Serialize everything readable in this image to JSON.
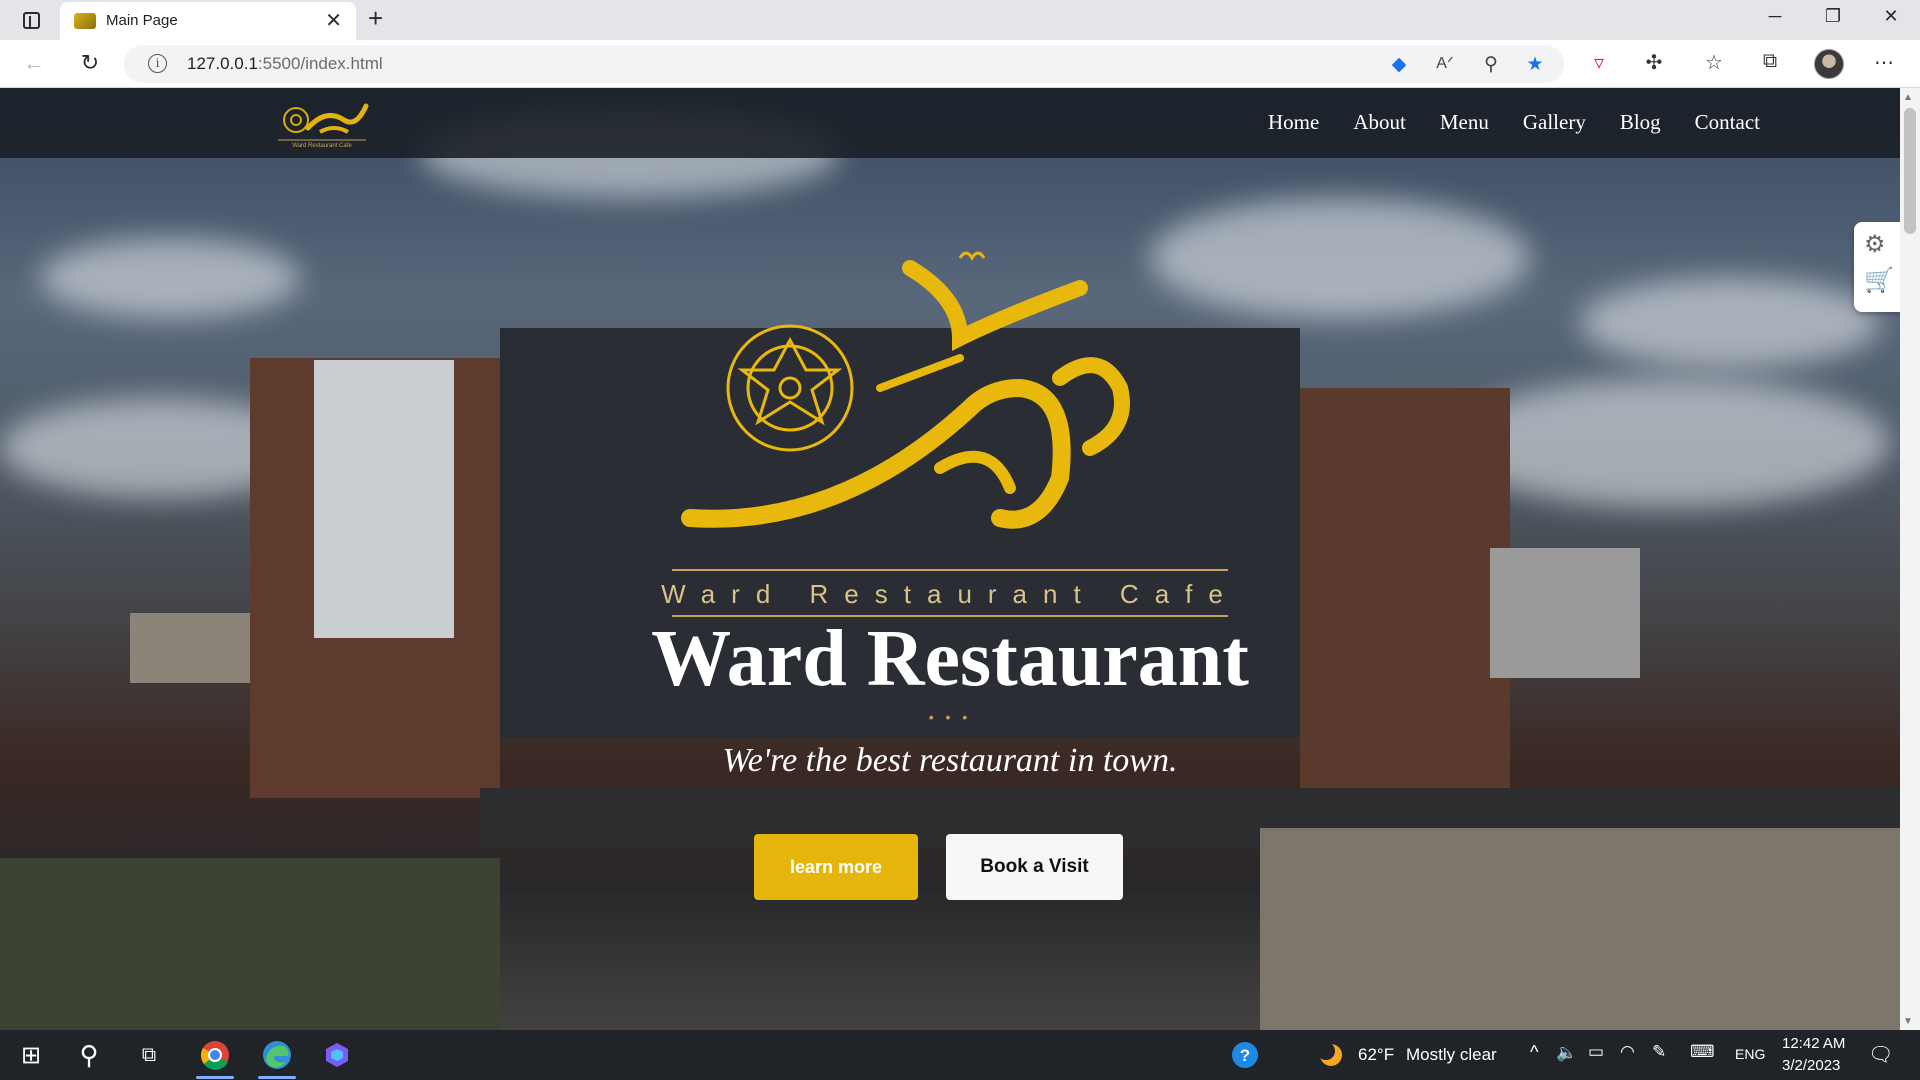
{
  "browser": {
    "tab_title": "Main Page",
    "url_host": "127.0.0.1",
    "url_path": ":5500/index.html"
  },
  "site": {
    "nav": [
      "Home",
      "About",
      "Menu",
      "Gallery",
      "Blog",
      "Contact"
    ],
    "logo_tagline": "Ward Restaurant Cafe",
    "hero_title": "Ward Restaurant",
    "hero_subtitle": "We're the best restaurant in town.",
    "learn_more_label": "learn more",
    "book_visit_label": "Book a Visit",
    "accent_color": "#e5b50c"
  },
  "taskbar": {
    "weather_temp": "62°F",
    "weather_text": "Mostly clear",
    "language": "ENG",
    "time": "12:42 AM",
    "date": "3/2/2023"
  }
}
